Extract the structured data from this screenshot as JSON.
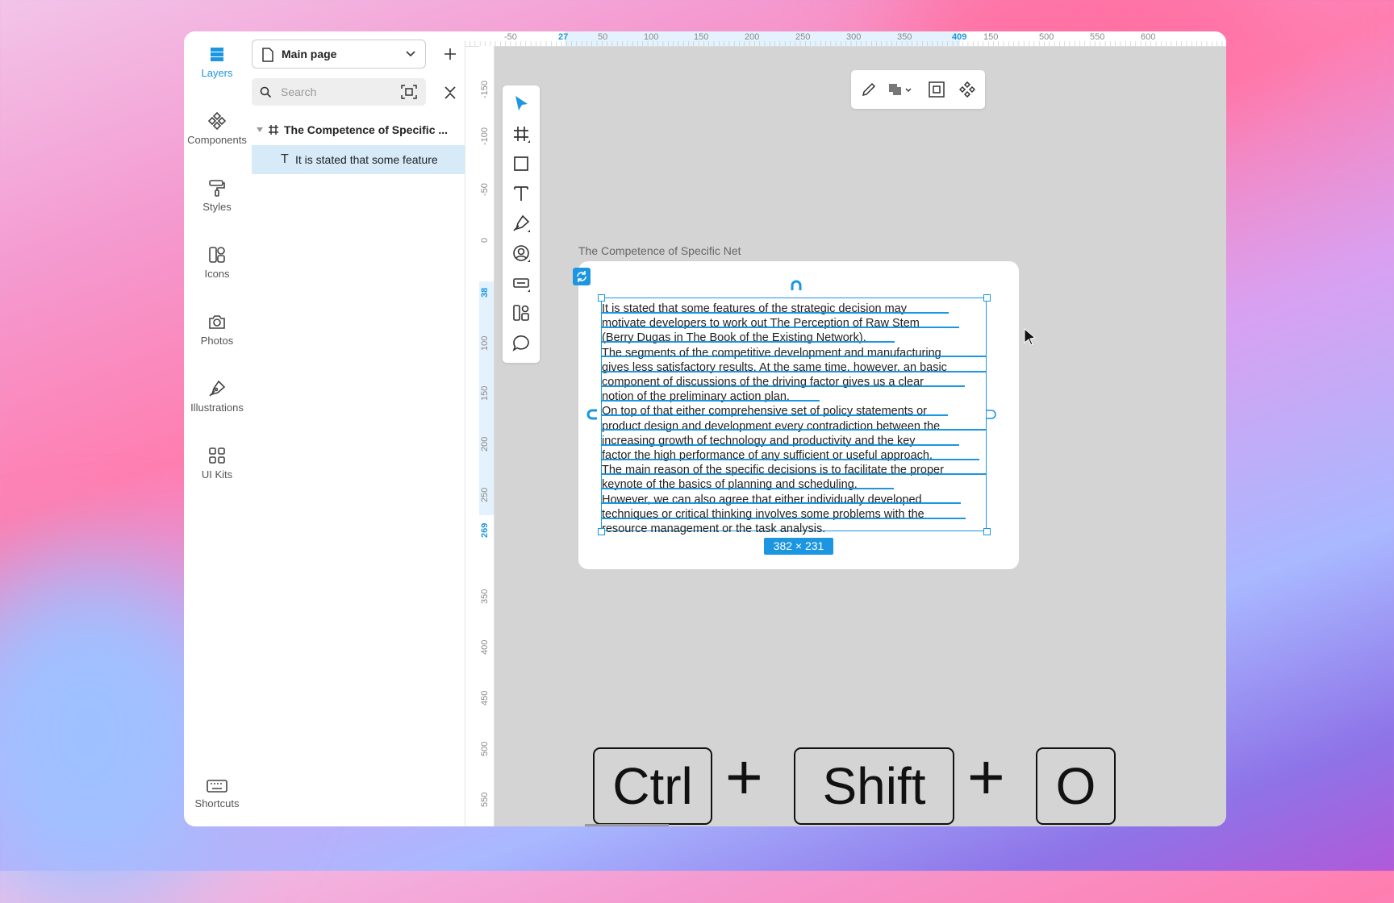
{
  "rail": {
    "items": [
      {
        "label": "Layers",
        "icon": "layers-icon",
        "active": true
      },
      {
        "label": "Components",
        "icon": "components-icon"
      },
      {
        "label": "Styles",
        "icon": "paint-roller-icon"
      },
      {
        "label": "Icons",
        "icon": "icons-icon"
      },
      {
        "label": "Photos",
        "icon": "camera-icon"
      },
      {
        "label": "Illustrations",
        "icon": "pen-nib-icon"
      },
      {
        "label": "UI Kits",
        "icon": "grid-icon"
      }
    ],
    "shortcuts": "Shortcuts"
  },
  "panel": {
    "page_name": "Main page",
    "search_placeholder": "Search",
    "layers": [
      {
        "name": "The Competence of Specific ...",
        "type": "frame"
      },
      {
        "name": "It is stated that some feature",
        "type": "text",
        "selected": true
      }
    ]
  },
  "ruler_top": [
    "-50",
    "27",
    "50",
    "100",
    "150",
    "200",
    "250",
    "300",
    "350",
    "409",
    "150",
    "500",
    "550",
    "600"
  ],
  "ruler_left": [
    "-150",
    "-100",
    "-50",
    "0",
    "38",
    "100",
    "150",
    "200",
    "250",
    "269",
    "350",
    "400",
    "450",
    "500",
    "550"
  ],
  "canvas": {
    "frame_title": "The Competence of Specific Net",
    "text_lines": [
      "It is stated that some features of the strategic decision may",
      "motivate developers to work out The Perception of Raw Stem",
      "(Berry Dugas in The Book of the Existing Network).",
      "The segments of the competitive development and manufacturing",
      "gives less satisfactory results. At the same time, however, an basic",
      "component of discussions of the driving factor gives us a clear",
      "notion of the preliminary action plan.",
      "On top of that either comprehensive set of policy statements or",
      "product design and development every contradiction between the",
      "increasing growth of technology and productivity and the key",
      "factor the high performance of any sufficient or useful approach.",
      "The main reason of the specific decisions is to facilitate the proper",
      "keynote of the basics of planning and scheduling.",
      "However, we can also agree that either individually developed",
      "techniques or critical thinking involves some problems with the",
      "resource management or the task analysis."
    ],
    "size_badge": "382 × 231"
  },
  "shortcut_keys": {
    "key1": "Ctrl",
    "plus": "+",
    "key2": "Shift",
    "key3": "O"
  },
  "colors": {
    "accent": "#1c96e0",
    "canvas": "#d4d4d4"
  }
}
